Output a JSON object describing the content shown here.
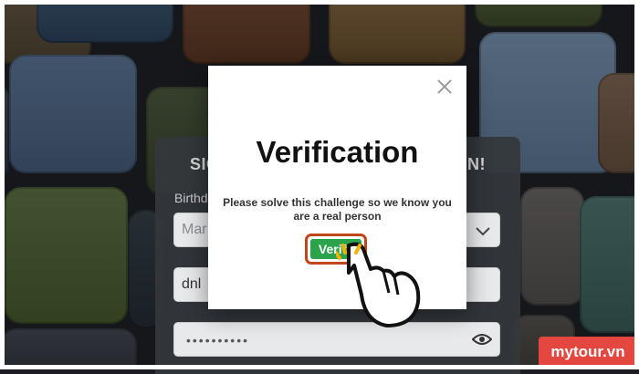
{
  "signup": {
    "title_left": "SIG",
    "title_right": "N!",
    "birthday_label": "Birthd",
    "birthday_month": "Mar",
    "username_value": "dnl",
    "password_mask": "••••••••••"
  },
  "modal": {
    "title": "Verification",
    "message": "Please solve this challenge so we know you are a real person",
    "verify_label": "Verify",
    "close_icon": "close-icon"
  },
  "watermark": {
    "text": "mytour.vn"
  },
  "colors": {
    "verify_green": "#2aa34a",
    "highlight_orange": "#c2461c",
    "badge_red": "#e4473f"
  }
}
